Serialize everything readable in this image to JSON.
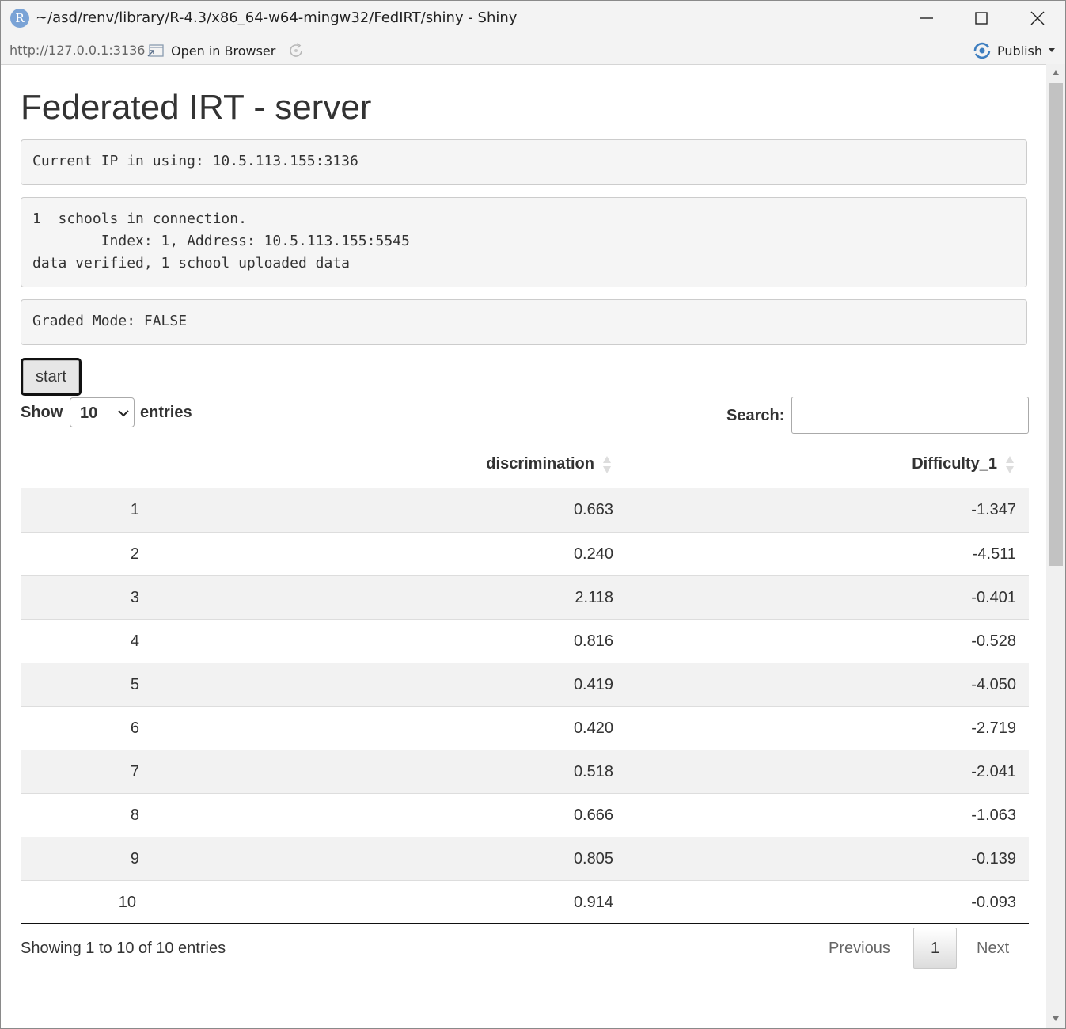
{
  "window": {
    "title": "~/asd/renv/library/R-4.3/x86_64-w64-mingw32/FedIRT/shiny - Shiny",
    "logo_letter": "R"
  },
  "toolbar": {
    "url": "http://127.0.0.1:3136",
    "open_in_browser": "Open in Browser",
    "publish": "Publish"
  },
  "page": {
    "title": "Federated IRT - server",
    "ip_line": "Current IP in using: 10.5.113.155:3136",
    "connection_lines": [
      "1  schools in connection.",
      "        Index: 1, Address: 10.5.113.155:5545",
      "data verified, 1 school uploaded data"
    ],
    "graded_mode": "Graded Mode: FALSE",
    "start_label": "start"
  },
  "table_controls": {
    "show_label": "Show",
    "page_length": "10",
    "entries_label": "entries",
    "search_label": "Search:",
    "search_value": ""
  },
  "table": {
    "columns": [
      "",
      "discrimination",
      "Difficulty_1"
    ],
    "rows": [
      [
        "1",
        "0.663",
        "-1.347"
      ],
      [
        "2",
        "0.240",
        "-4.511"
      ],
      [
        "3",
        "2.118",
        "-0.401"
      ],
      [
        "4",
        "0.816",
        "-0.528"
      ],
      [
        "5",
        "0.419",
        "-4.050"
      ],
      [
        "6",
        "0.420",
        "-2.719"
      ],
      [
        "7",
        "0.518",
        "-2.041"
      ],
      [
        "8",
        "0.666",
        "-1.063"
      ],
      [
        "9",
        "0.805",
        "-0.139"
      ],
      [
        "10",
        "0.914",
        "-0.093"
      ]
    ]
  },
  "pagination": {
    "info": "Showing 1 to 10 of 10 entries",
    "previous": "Previous",
    "current_page": "1",
    "next": "Next"
  }
}
